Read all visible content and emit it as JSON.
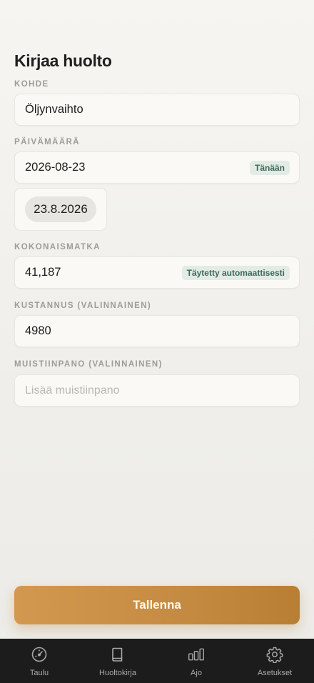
{
  "page": {
    "title": "Kirjaa huolto"
  },
  "form": {
    "target": {
      "label": "KOHDE",
      "value": "Öljynvaihto"
    },
    "date": {
      "label": "PÄIVÄMÄÄRÄ",
      "value": "2026-08-23",
      "badge": "Tänään",
      "picker_value": "23.8.2026"
    },
    "odometer": {
      "label": "KOKONAISMATKA",
      "value": "41,187",
      "badge": "Täytetty automaattisesti"
    },
    "cost": {
      "label": "KUSTANNUS (VALINNAINEN)",
      "value": "4980"
    },
    "note": {
      "label": "MUISTIINPANO (VALINNAINEN)",
      "placeholder": "Lisää muistiinpano"
    }
  },
  "actions": {
    "save_label": "Tallenna"
  },
  "tabbar": {
    "items": [
      {
        "label": "Taulu",
        "icon": "gauge-icon"
      },
      {
        "label": "Huoltokirja",
        "icon": "book-icon"
      },
      {
        "label": "Ajo",
        "icon": "bar-chart-icon"
      },
      {
        "label": "Asetukset",
        "icon": "gear-icon"
      }
    ]
  },
  "colors": {
    "accent": "#c78d44",
    "badge_text": "#3d6a58",
    "badge_bg": "#e3ebe5",
    "tabbar_bg": "#1c1c1c"
  }
}
